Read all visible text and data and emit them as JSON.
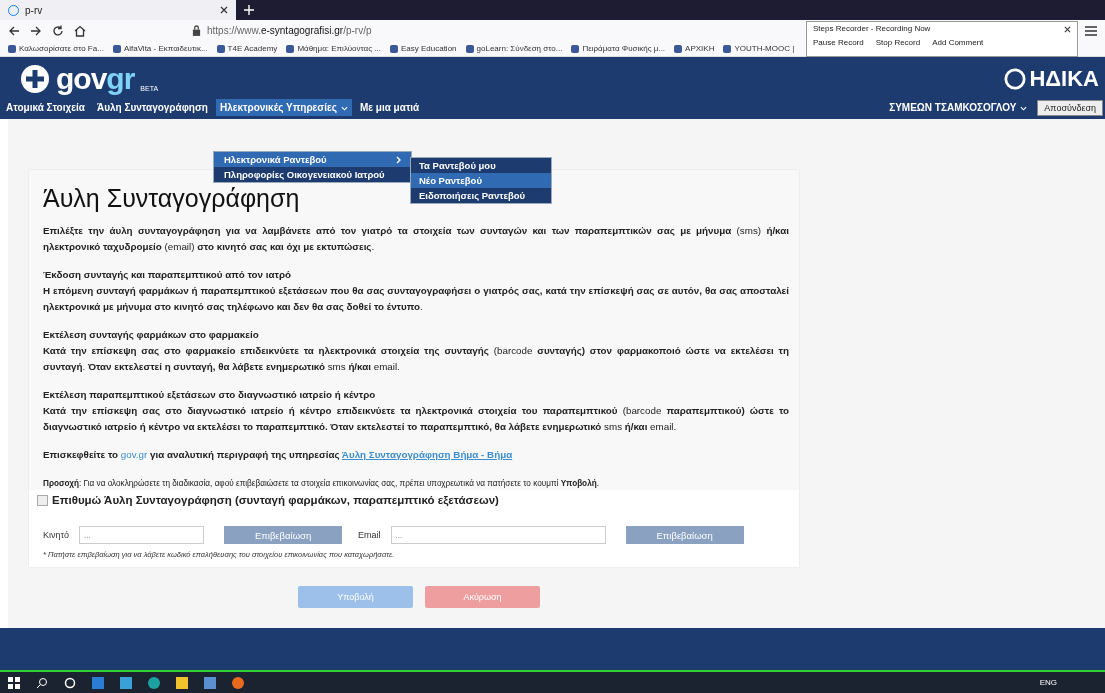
{
  "browser": {
    "tab_title": "p-rv",
    "url_prefix": "https://www.",
    "url_domain": "e-syntagografisi.gr",
    "url_path": "/p-rv/p",
    "bookmarks": [
      "Καλωσορίσατε στο Fa...",
      "AlfaVita - Εκπαιδευτικ...",
      "T4E Academy",
      "Μάθημα: Επιλύοντας ...",
      "Easy Education",
      "goLearn: Σύνδεση στο...",
      "Πειράματα Φυσικής μ...",
      "ΑΡΧΙΚΗ",
      "YOUTH-MOOC |"
    ]
  },
  "recorder": {
    "title": "Steps Recorder - Recording Now",
    "buttons": [
      "Pause Record",
      "Stop Record",
      "Add Comment"
    ]
  },
  "header": {
    "logo": {
      "gov": "gov",
      "gr": "gr",
      "badge": "BETA"
    },
    "partner_logo": "ΗΔΙΚΑ",
    "nav": [
      {
        "label": "Ατομικά Στοιχεία",
        "selected": false,
        "dropdown": false
      },
      {
        "label": "Άυλη Συνταγογράφηση",
        "selected": false,
        "dropdown": false
      },
      {
        "label": "Ηλεκτρονικές Υπηρεσίες",
        "selected": true,
        "dropdown": true
      },
      {
        "label": "Με μια ματιά",
        "selected": false,
        "dropdown": false
      }
    ],
    "user": "ΣΥΜΕΩΝ ΤΣΑΜΚΟΣΟΓΛΟΥ",
    "logout": "Αποσύνδεση"
  },
  "menu": [
    {
      "label": "Ηλεκτρονικά Ραντεβού",
      "selected": true,
      "submenu": true
    },
    {
      "label": "Πληροφορίες Οικογενειακού Ιατρού",
      "selected": false,
      "submenu": false
    }
  ],
  "submenu": [
    {
      "label": "Τα Ραντεβού μου",
      "selected": false
    },
    {
      "label": "Νέο Ραντεβού",
      "selected": true
    },
    {
      "label": "Ειδοποιήσεις Ραντεβού",
      "selected": false
    }
  ],
  "page": {
    "title": "Άυλη Συνταγογράφηση",
    "intro": "**Επιλέξτε την άυλη συνταγογράφηση για να λαμβάνετε από τον γιατρό τα στοιχεία των συνταγών και των παραπεμπτικών σας με μήνυμα** (sms) **ή/και ηλεκτρονικό ταχυδρομείο** (email) **στο κινητό σας και όχι με εκτυπώσεις**.",
    "sections": [
      {
        "heading": "Έκδοση συνταγής και παραπεμπτικού από τον ιατρό",
        "body": "**Η επόμενη συνταγή φαρμάκων ή παραπεμπτικού εξετάσεων που θα σας συνταγογραφήσει ο γιατρός σας, κατά την επίσκεψή σας σε αυτόν, θα σας αποσταλεί ηλεκτρονικά με μήνυμα στο κινητό σας τηλέφωνο και δεν θα σας δοθεί το έντυπο**."
      },
      {
        "heading": "Εκτέλεση συνταγής φαρμάκων στο φαρμακείο",
        "body": "**Κατά την επίσκεψη σας στο φαρμακείο επιδεικνύετε τα ηλεκτρονικά στοιχεία της συνταγής** (barcode **συνταγής) στον φαρμακοποιό ώστε να εκτελέσει τη συνταγή**. **Όταν εκτελεστεί η συνταγή, θα λάβετε ενημερωτικό** sms **ή/και** email."
      },
      {
        "heading": "Εκτέλεση παραπεμπτικού εξετάσεων στο διαγνωστικό ιατρείο ή κέντρο",
        "body": "**Κατά την επίσκεψη σας στο διαγνωστικό ιατρείο ή κέντρο επιδεικνύετε τα ηλεκτρονικά στοιχεία του παραπεμπτικού** (barcode **παραπεμπτικού) ώστε το διαγνωστικό ιατρείο ή κέντρο να εκτελέσει το παραπεμπτικό. Όταν εκτελεστεί το παραπεμπτικό, θα λάβετε ενημερωτικό** sms **ή/και** email."
      }
    ],
    "visit": {
      "before": "Επισκεφθείτε το",
      "link1": "gov.gr",
      "middle": "για αναλυτική περιγραφή της υπηρεσίας",
      "link2": "Άυλη Συνταγογράφηση Βήμα - Βήμα"
    },
    "notice": "**Προσοχή**: Για να ολοκληρώσετε τη διαδικασία, αφού επιβεβαιώσετε τα στοιχεία επικοινωνίας σας, πρέπει υποχρεωτικά να πατήσετε το κουμπί **Υποβολή**.",
    "consent": {
      "label": "Επιθυμώ Άυλη Συνταγογράφηση (συνταγή φαρμάκων, παραπεμπτικό εξετάσεων)",
      "checked": false
    },
    "fields": [
      {
        "label": "Κινητό",
        "placeholder": "...",
        "button": "Επιβεβαίωση"
      },
      {
        "label": "Email",
        "placeholder": "...",
        "button": "Επιβεβαίωση"
      }
    ],
    "hint": "* Πατήστε επιβεβαίωση για να λάβετε κωδικό επαλήθευσης του στοιχείου επικοινωνίας που καταχωρήσατε.",
    "actions": [
      {
        "label": "Υποβολή",
        "kind": "primary"
      },
      {
        "label": "Ακύρωση",
        "kind": "cancel"
      }
    ]
  },
  "taskbar": {
    "language": "ENG"
  }
}
